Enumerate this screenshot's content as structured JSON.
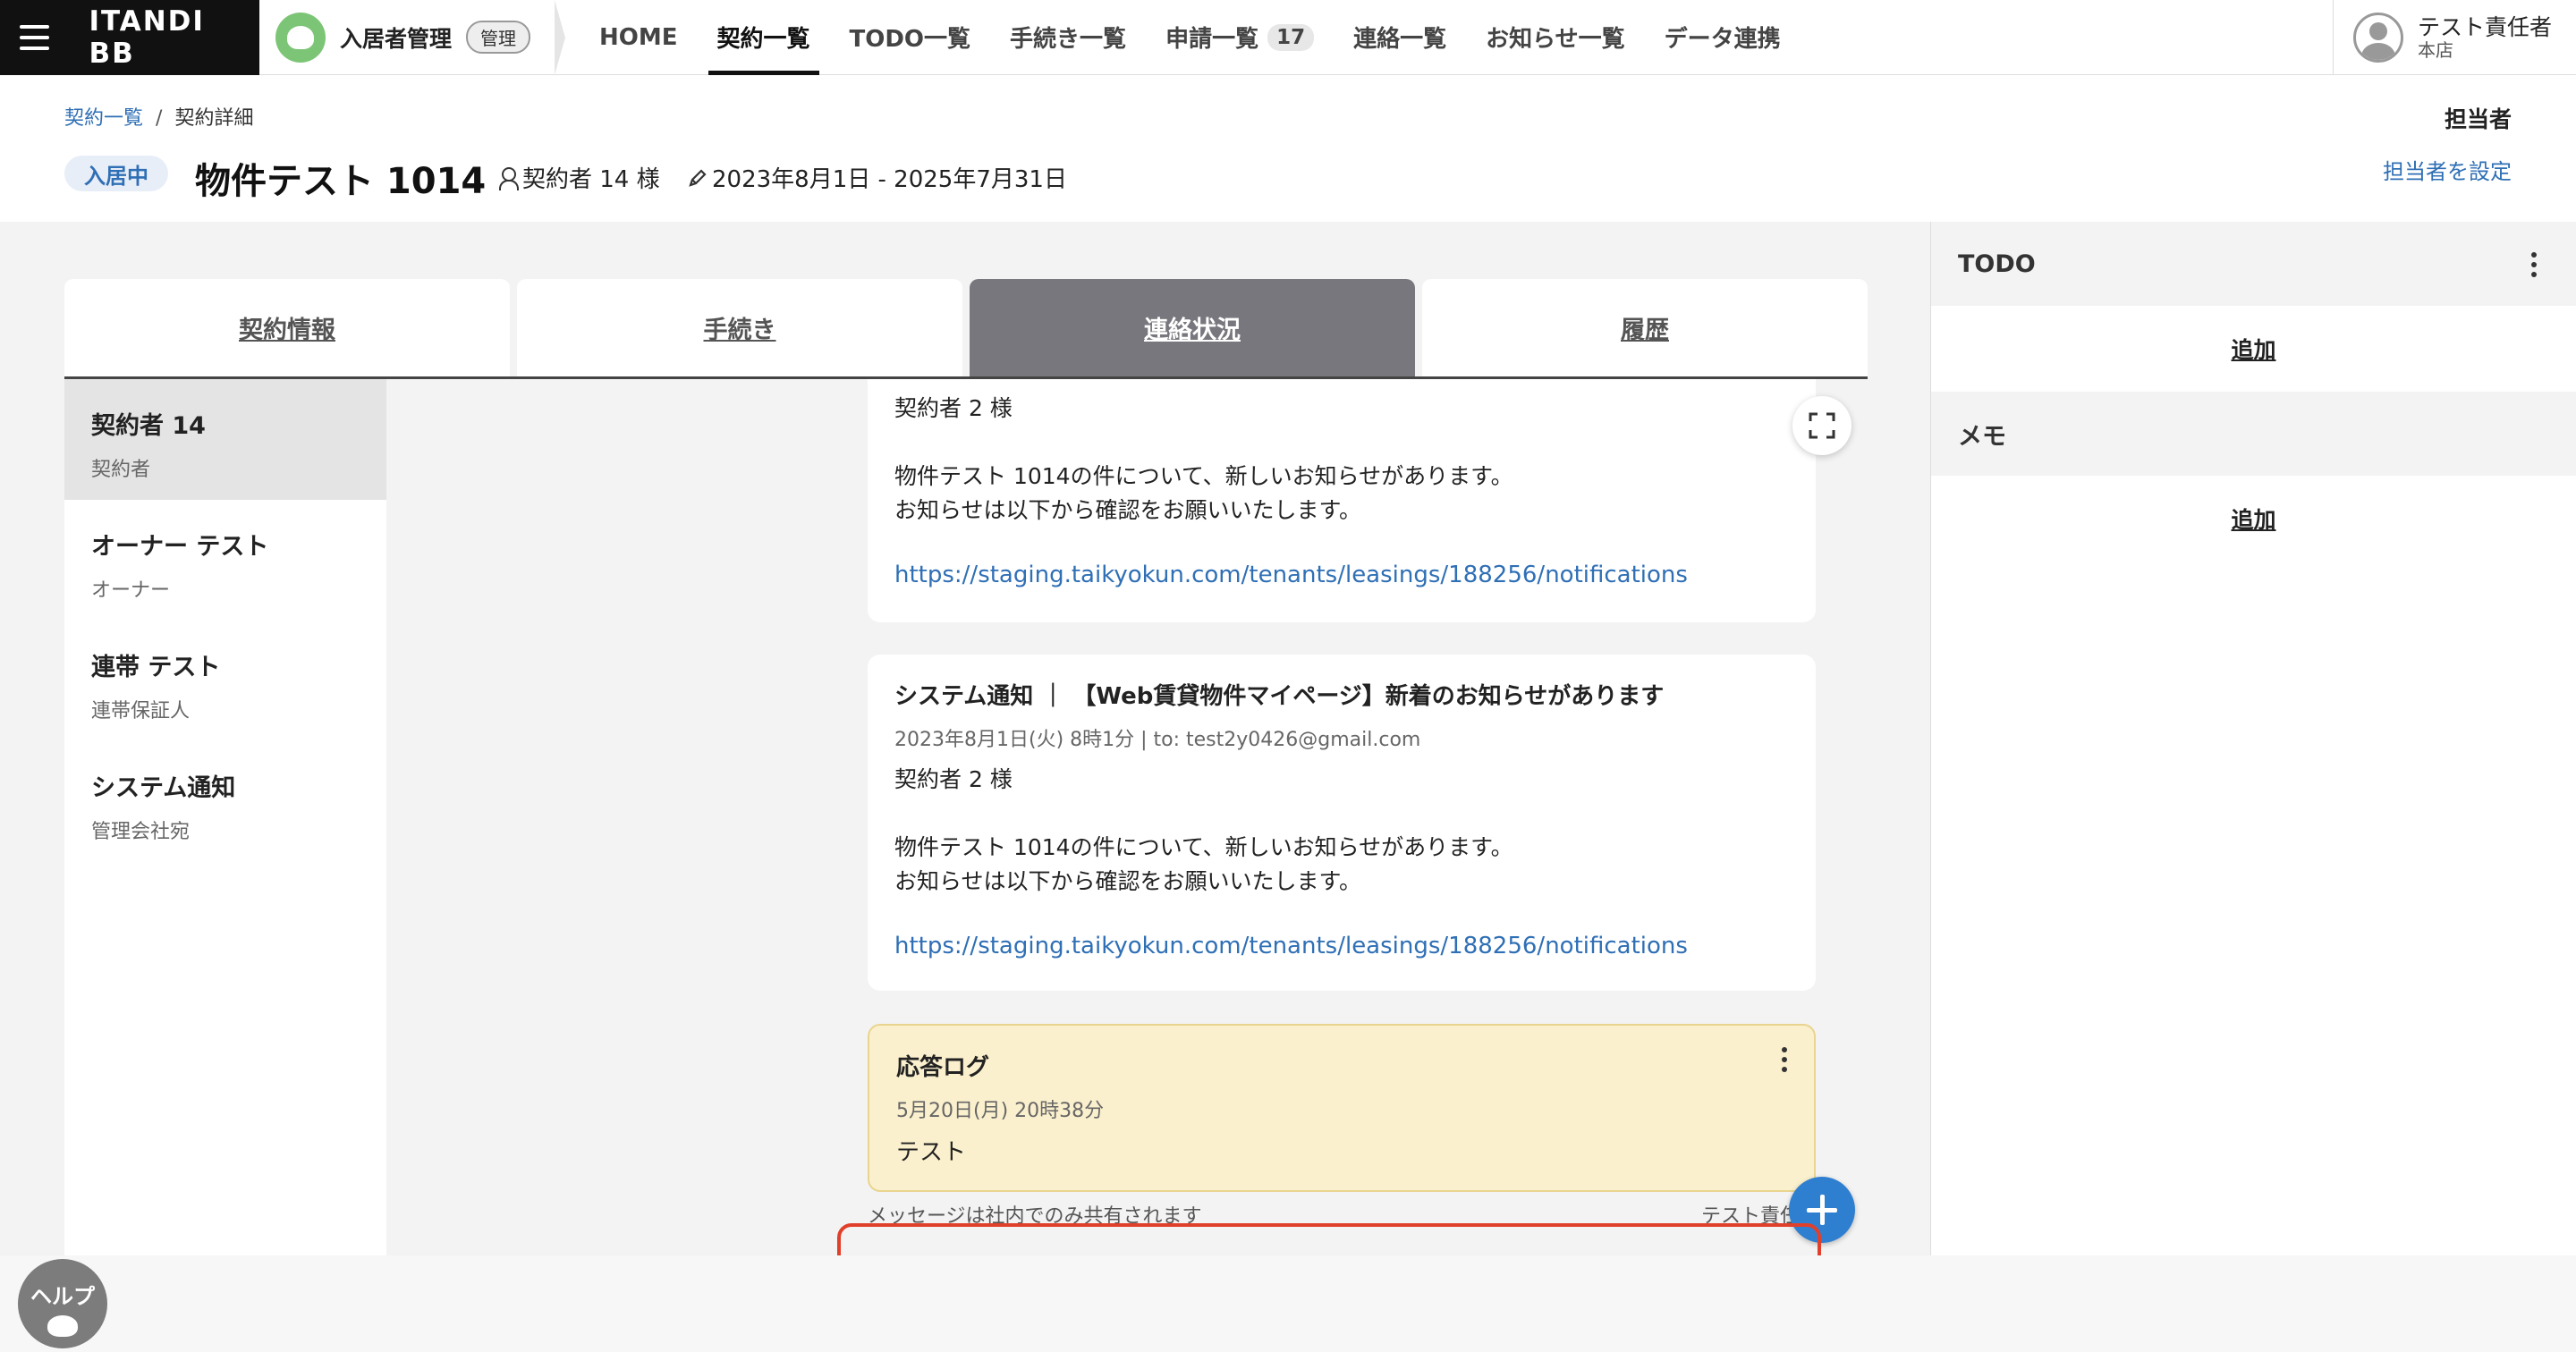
{
  "topbar": {
    "brand": "ITANDI BB",
    "app_name": "入居者管理",
    "app_badge": "管理",
    "nav": [
      {
        "label": "HOME"
      },
      {
        "label": "契約一覧"
      },
      {
        "label": "TODO一覧"
      },
      {
        "label": "手続き一覧"
      },
      {
        "label": "申請一覧",
        "count": "17"
      },
      {
        "label": "連絡一覧"
      },
      {
        "label": "お知らせ一覧"
      },
      {
        "label": "データ連携"
      }
    ],
    "active_nav": "契約一覧",
    "user": {
      "name": "テスト責任者",
      "branch": "本店"
    }
  },
  "breadcrumb": {
    "root": "契約一覧",
    "current": "契約詳細"
  },
  "contract": {
    "status": "入居中",
    "title": "物件テスト 1014",
    "contractor": "契約者 14 様",
    "period": "2023年8月1日 - 2025年7月31日"
  },
  "assignee": {
    "heading": "担当者",
    "set_link": "担当者を設定"
  },
  "tabs": [
    {
      "label": "契約情報"
    },
    {
      "label": "手続き"
    },
    {
      "label": "連絡状況"
    },
    {
      "label": "履歴"
    }
  ],
  "active_tab": "連絡状況",
  "contacts": [
    {
      "name": "契約者 14",
      "role": "契約者"
    },
    {
      "name": "オーナー テスト",
      "role": "オーナー"
    },
    {
      "name": "連帯 テスト",
      "role": "連帯保証人"
    },
    {
      "name": "システム通知",
      "role": "管理会社宛"
    }
  ],
  "messages": [
    {
      "greeting": "契約者 2 様",
      "line1": "物件テスト 1014の件について、新しいお知らせがあります。",
      "line2": "お知らせは以下から確認をお願いいたします。",
      "link": "https://staging.taikyokun.com/tenants/leasings/188256/notifications"
    },
    {
      "title": "システム通知 ｜ 【Web賃貸物件マイページ】新着のお知らせがあります",
      "meta": "2023年8月1日(火) 8時1分  |  to: test2y0426@gmail.com",
      "greeting": "契約者 2 様",
      "line1": "物件テスト 1014の件について、新しいお知らせがあります。",
      "line2": "お知らせは以下から確認をお願いいたします。",
      "link": "https://staging.taikyokun.com/tenants/leasings/188256/notifications"
    }
  ],
  "response_log": {
    "title": "応答ログ",
    "date": "5月20日(月) 20時38分",
    "body": "テスト"
  },
  "share_note": "メッセージは社内でのみ共有されます",
  "sender_name": "テスト責任者",
  "side_panel": {
    "todo_heading": "TODO",
    "todo_add": "追加",
    "memo_heading": "メモ",
    "memo_add": "追加"
  },
  "help": {
    "label": "ヘルプ"
  },
  "colors": {
    "link": "#2f6fb5",
    "active_tab": "#77777d",
    "response_bg": "#fbf0cd",
    "fab": "#2f7fd0",
    "highlight": "#e0402a"
  }
}
